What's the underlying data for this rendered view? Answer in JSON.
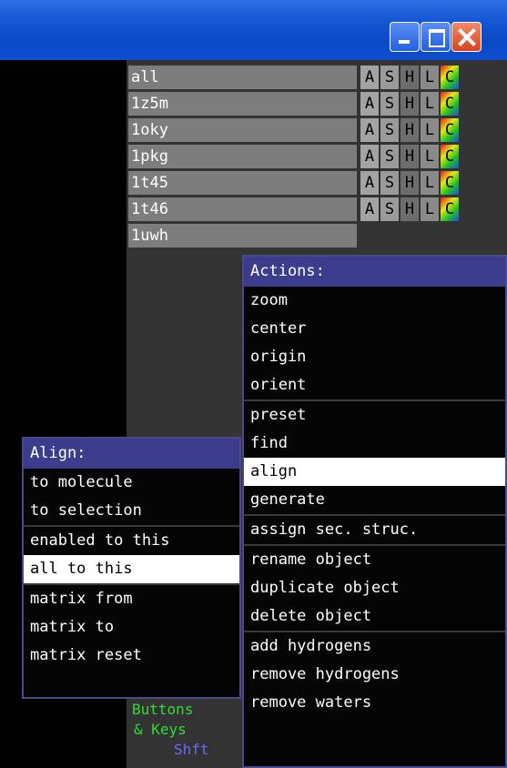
{
  "window": {
    "buttons": [
      "minimize-icon",
      "maximize-icon",
      "close-icon"
    ],
    "title_color": "#0a49c8"
  },
  "objects": [
    {
      "name": "all",
      "controls": [
        "A",
        "S",
        "H",
        "L",
        "C"
      ]
    },
    {
      "name": "1z5m",
      "controls": [
        "A",
        "S",
        "H",
        "L",
        "C"
      ]
    },
    {
      "name": "1oky",
      "controls": [
        "A",
        "S",
        "H",
        "L",
        "C"
      ]
    },
    {
      "name": "1pkg",
      "controls": [
        "A",
        "S",
        "H",
        "L",
        "C"
      ]
    },
    {
      "name": "1t45",
      "controls": [
        "A",
        "S",
        "H",
        "L",
        "C"
      ]
    },
    {
      "name": "1t46",
      "controls": [
        "A",
        "S",
        "H",
        "L",
        "C"
      ]
    },
    {
      "name": "1uwh",
      "controls": []
    }
  ],
  "actions_menu": {
    "title": "Actions:",
    "groups": [
      [
        "zoom",
        "center",
        "origin",
        "orient"
      ],
      [
        "preset",
        "find",
        "align",
        "generate"
      ],
      [
        "assign sec. struc."
      ],
      [
        "rename object",
        "duplicate object",
        "delete object"
      ],
      [
        "add hydrogens",
        "remove hydrogens",
        "remove waters"
      ]
    ],
    "selected": "align"
  },
  "align_menu": {
    "title": "Align:",
    "groups": [
      [
        "to molecule",
        "to selection"
      ],
      [
        "enabled to this",
        "all to this"
      ],
      [
        "matrix from",
        "matrix to",
        "matrix reset"
      ]
    ],
    "selected": "all to this"
  },
  "buttons_keys": {
    "line1": "Buttons",
    "line2": "& Keys",
    "line3": "Shft"
  }
}
